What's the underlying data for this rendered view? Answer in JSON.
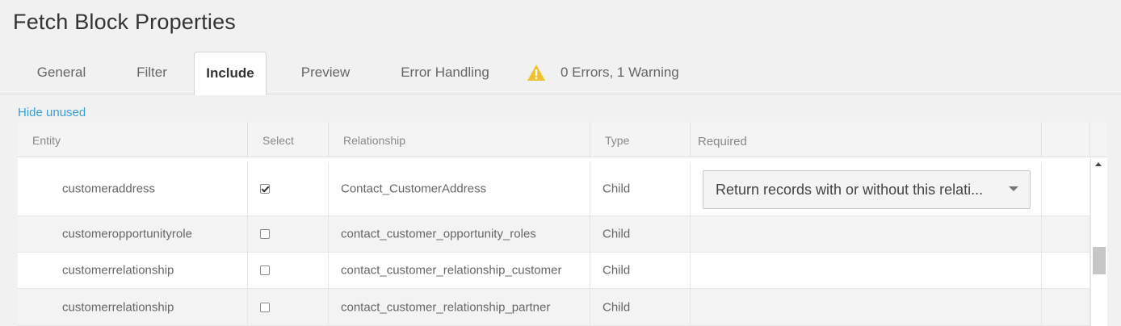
{
  "title": "Fetch Block Properties",
  "tabs": [
    {
      "label": "General",
      "active": false
    },
    {
      "label": "Filter",
      "active": false
    },
    {
      "label": "Include",
      "active": true
    },
    {
      "label": "Preview",
      "active": false
    },
    {
      "label": "Error Handling",
      "active": false
    }
  ],
  "status": {
    "icon": "warning-icon",
    "text": "0 Errors, 1 Warning",
    "icon_color": "#f2c12e"
  },
  "hide_unused_label": "Hide unused",
  "table": {
    "headers": [
      "Entity",
      "Select",
      "Relationship",
      "Type",
      "Required",
      ""
    ],
    "rows": [
      {
        "entity": "customeraddress",
        "selected": true,
        "relationship": "Contact_CustomerAddress",
        "type": "Child",
        "required": "Return records with or without this relati..."
      },
      {
        "entity": "customeropportunityrole",
        "selected": false,
        "relationship": "contact_customer_opportunity_roles",
        "type": "Child",
        "required": ""
      },
      {
        "entity": "customerrelationship",
        "selected": false,
        "relationship": "contact_customer_relationship_customer",
        "type": "Child",
        "required": ""
      },
      {
        "entity": "customerrelationship",
        "selected": false,
        "relationship": "contact_customer_relationship_partner",
        "type": "Child",
        "required": ""
      }
    ]
  },
  "colors": {
    "accent_link": "#3aa0d4",
    "background": "#f1f1f1"
  }
}
